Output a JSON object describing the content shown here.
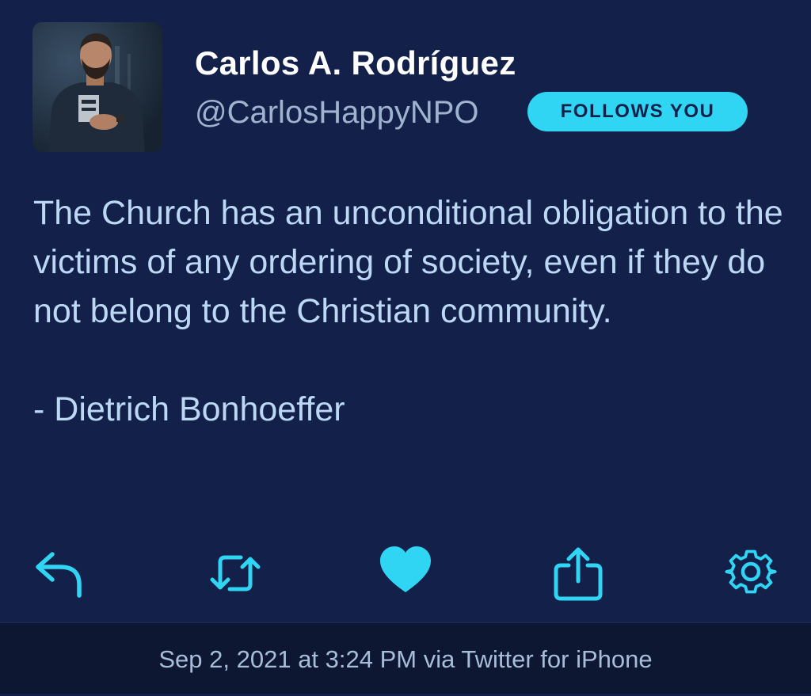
{
  "author": {
    "name": "Carlos A. Rodríguez",
    "handle": "@CarlosHappyNPO",
    "badge": "FOLLOWS YOU"
  },
  "tweet": {
    "text": "The Church has an unconditional obligation to the victims of any ordering of society, even if they do not belong to the Christian community.\n\n- Dietrich Bonhoeffer"
  },
  "actions": [
    {
      "icon": "reply-icon"
    },
    {
      "icon": "retweet-icon"
    },
    {
      "icon": "heart-icon"
    },
    {
      "icon": "share-icon"
    },
    {
      "icon": "gear-icon"
    }
  ],
  "footer": {
    "timestamp": "Sep 2, 2021 at 3:24 PM via Twitter for iPhone"
  },
  "colors": {
    "background": "#13204a",
    "accent": "#2fd5f3",
    "text": "#bcd8f5",
    "footer_background": "#0d1732"
  }
}
